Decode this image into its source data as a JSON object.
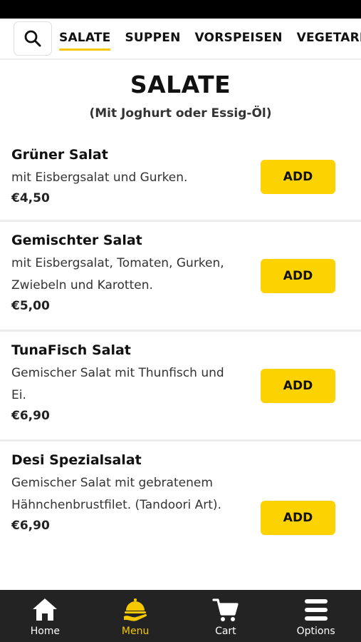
{
  "categories": {
    "tabs": [
      {
        "label": "SALATE",
        "active": true
      },
      {
        "label": "SUPPEN",
        "active": false
      },
      {
        "label": "VORSPEISEN",
        "active": false
      },
      {
        "label": "VEGETARISCH",
        "active": false
      }
    ]
  },
  "section": {
    "title": "SALATE",
    "subtitle": "(Mit Joghurt oder Essig-Öl)"
  },
  "items": [
    {
      "name": "Grüner Salat",
      "description": "mit Eisbergsalat und Gurken.",
      "price": "€4,50",
      "button": "ADD"
    },
    {
      "name": "Gemischter Salat",
      "description": "mit Eisbergsalat, Tomaten, Gurken, Zwiebeln und Karotten.",
      "price": "€5,00",
      "button": "ADD"
    },
    {
      "name": "TunaFisch Salat",
      "description": "Gemischer Salat mit Thunfisch und Ei.",
      "price": "€6,90",
      "button": "ADD"
    },
    {
      "name": "Desi Spezialsalat",
      "description": "Gemischer Salat mit gebratenem Hähnchenbrustfilet. (Tandoori Art).",
      "price": "€6,90",
      "button": "ADD"
    }
  ],
  "nav": {
    "home": "Home",
    "menu": "Menu",
    "cart": "Cart",
    "options": "Options"
  },
  "colors": {
    "accent": "#fcd200",
    "nav_background": "#232323",
    "status_bar": "#000000"
  },
  "icons": {
    "search": "search-icon",
    "home": "home-icon",
    "menu": "food-service-icon",
    "cart": "cart-icon",
    "options": "hamburger-menu-icon"
  }
}
